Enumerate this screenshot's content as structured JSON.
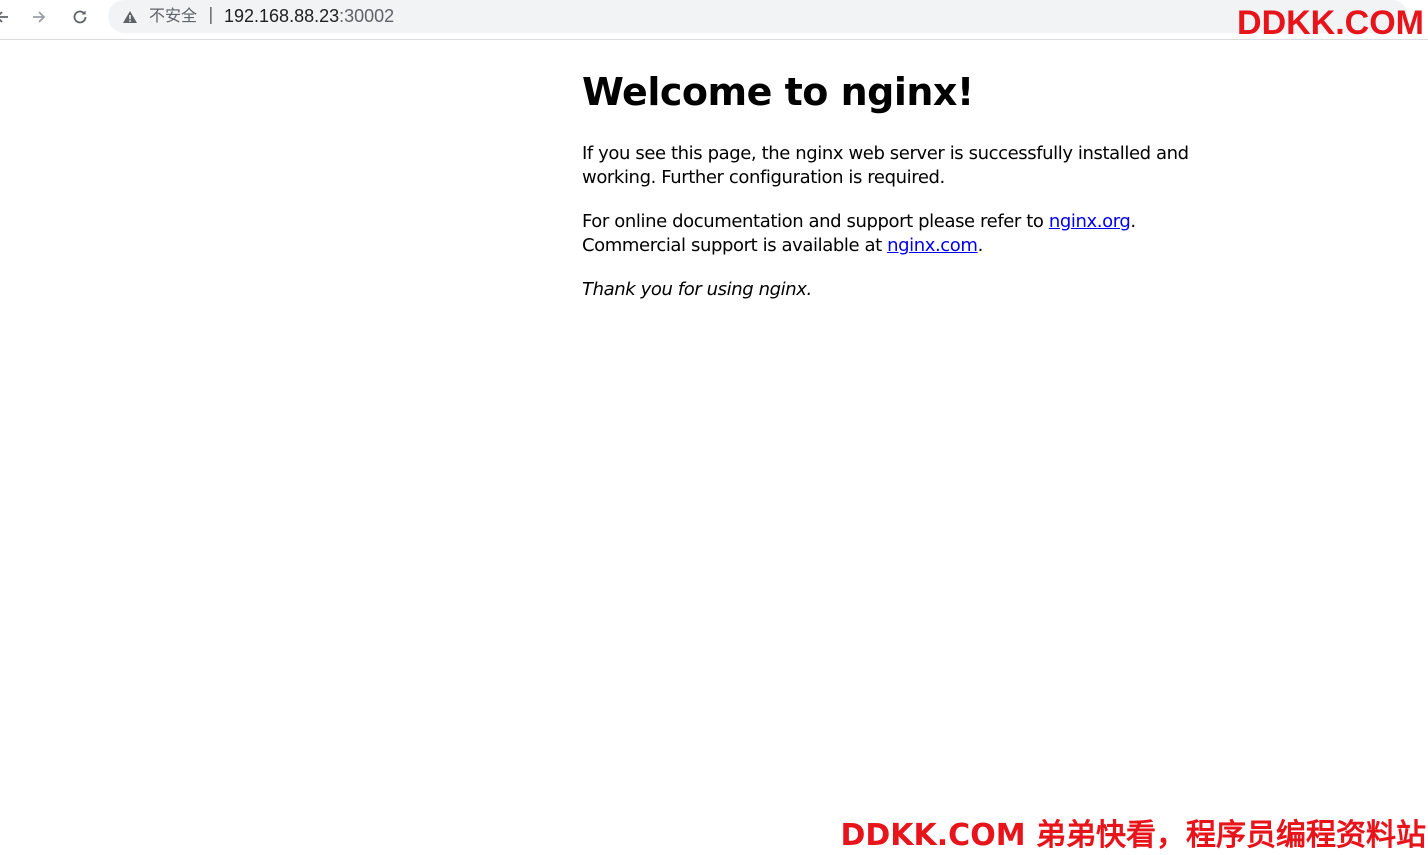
{
  "browser": {
    "security_label": "不安全",
    "separator": "|",
    "url_host": "192.168.88.23",
    "url_port": ":30002"
  },
  "watermark": {
    "top": "DDKK.COM",
    "bottom": "DDKK.COM 弟弟快看，程序员编程资料站"
  },
  "page": {
    "title": "Welcome to nginx!",
    "para1": "If you see this page, the nginx web server is successfully installed and working. Further configuration is required.",
    "para2_prefix": "For online documentation and support please refer to ",
    "link_org": "nginx.org",
    "para2_mid": ".",
    "para2_line2_prefix": "Commercial support is available at ",
    "link_com": "nginx.com",
    "para2_suffix": ".",
    "para3": "Thank you for using nginx."
  },
  "colors": {
    "link": "#0000ee",
    "watermark": "#e8141b",
    "omnibox_bg": "#f1f3f4"
  }
}
